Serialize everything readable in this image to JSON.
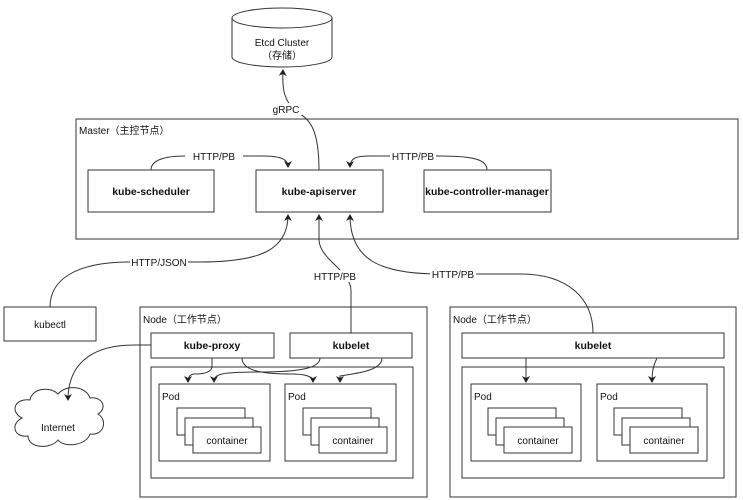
{
  "etcd": {
    "line1": "Etcd Cluster",
    "line2": "（存储）"
  },
  "master": {
    "title": "Master（主控节点）",
    "scheduler": "kube-scheduler",
    "apiserver": "kube-apiserver",
    "controller": "kube-controller-manager"
  },
  "kubectl": "kubectl",
  "internet": "Internet",
  "node1": {
    "title": "Node（工作节点）",
    "proxy": "kube-proxy",
    "kubelet": "kubelet",
    "pods": [
      {
        "label": "Pod",
        "container": "container"
      },
      {
        "label": "Pod",
        "container": "container"
      }
    ]
  },
  "node2": {
    "title": "Node（工作节点）",
    "kubelet": "kubelet",
    "pods": [
      {
        "label": "Pod",
        "container": "container"
      },
      {
        "label": "Pod",
        "container": "container"
      }
    ]
  },
  "edges": {
    "grpc": "gRPC",
    "sched_api": "HTTP/PB",
    "ctrl_api": "HTTP/PB",
    "kubectl_api": "HTTP/JSON",
    "node1_api": "HTTP/PB",
    "node2_api": "HTTP/PB"
  }
}
